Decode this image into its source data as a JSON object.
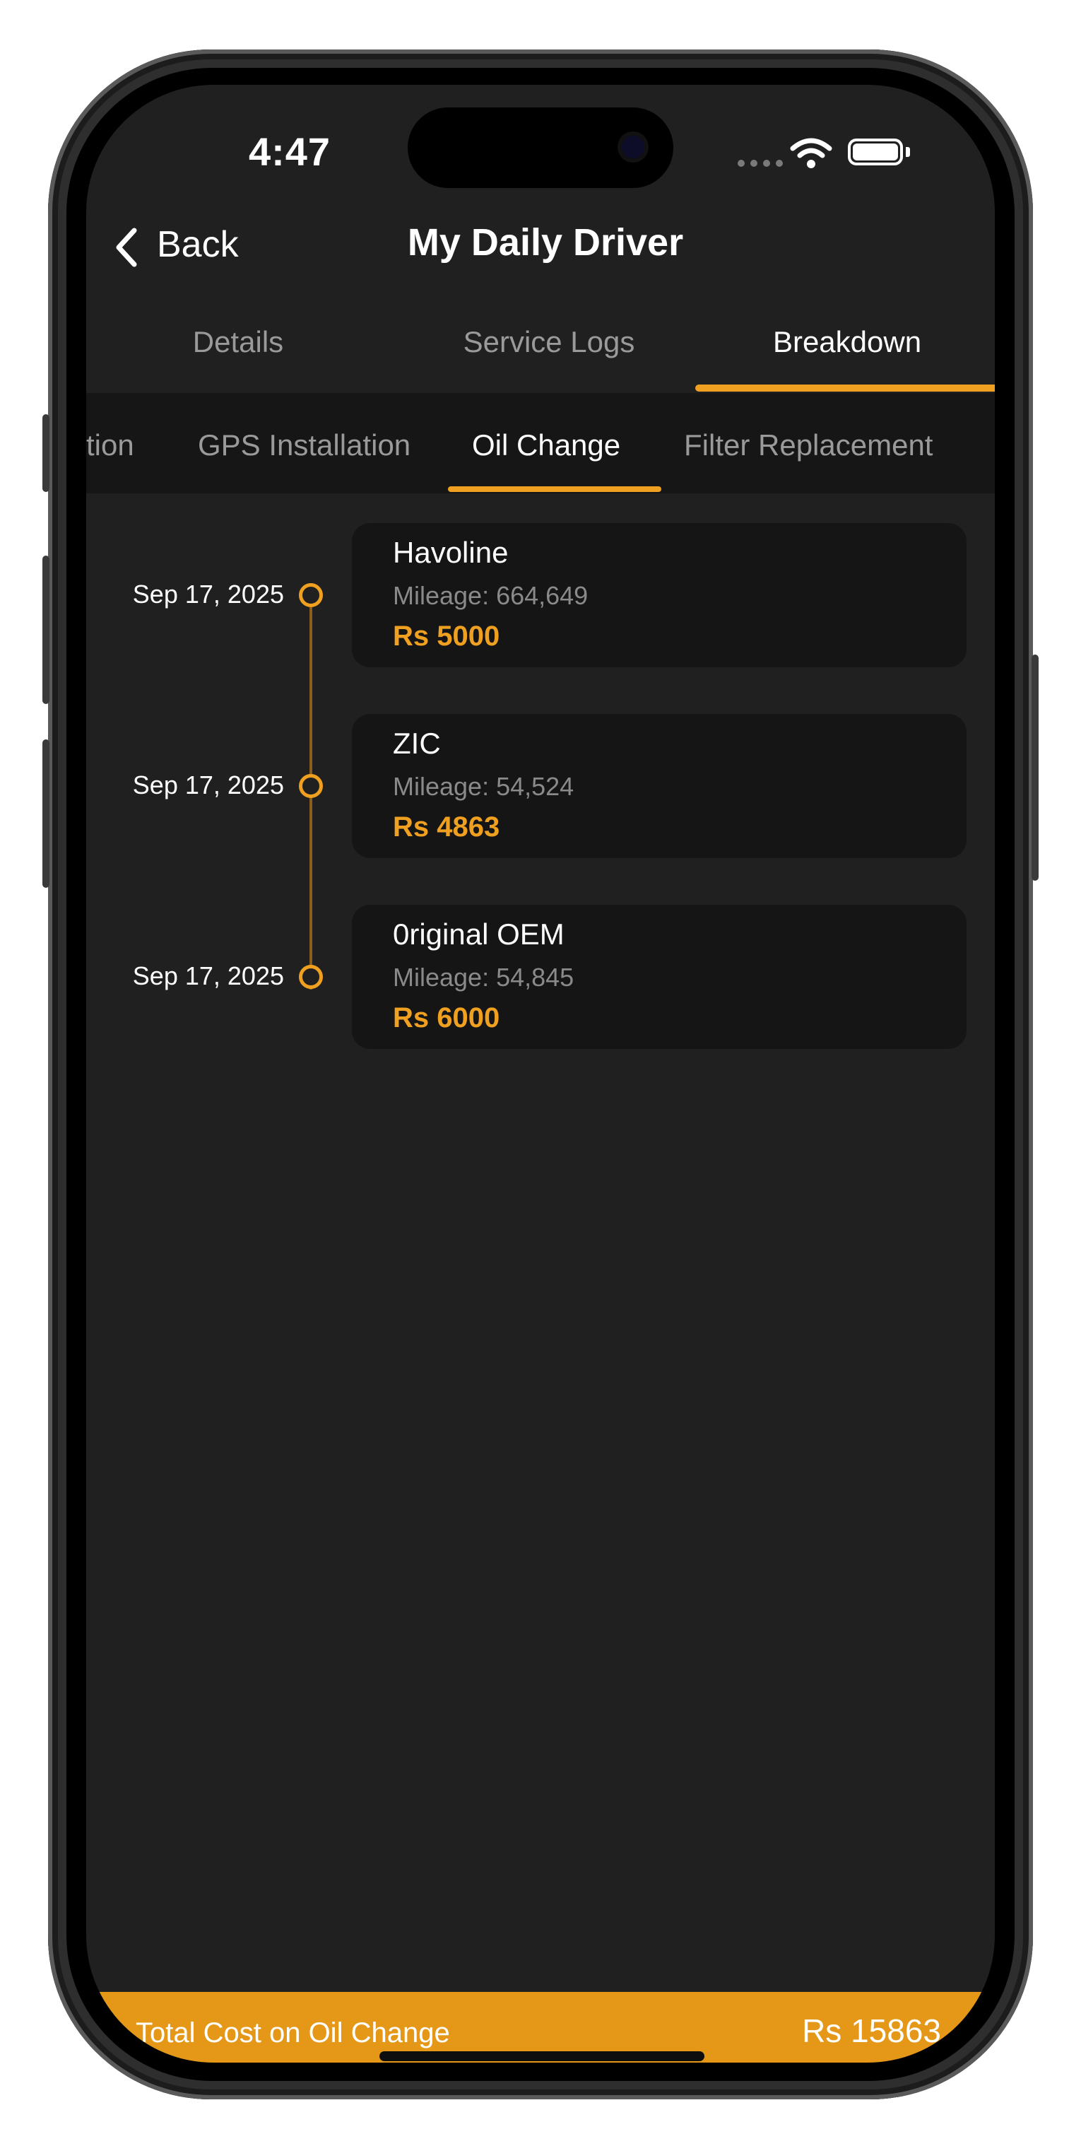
{
  "status_bar": {
    "time": "4:47"
  },
  "header": {
    "back_label": "Back",
    "title": "My Daily Driver"
  },
  "main_tabs": [
    {
      "label": "Details"
    },
    {
      "label": "Service Logs"
    },
    {
      "label": "Breakdown"
    }
  ],
  "active_main_tab": "Breakdown",
  "sub_tabs": [
    {
      "label": "tion"
    },
    {
      "label": "GPS Installation"
    },
    {
      "label": "Oil Change"
    },
    {
      "label": "Filter Replacement"
    }
  ],
  "active_sub_tab": "Oil Change",
  "entries": [
    {
      "date": "Sep 17, 2025",
      "title": "Havoline",
      "mileage": "Mileage: 664,649",
      "cost": "Rs 5000"
    },
    {
      "date": "Sep 17, 2025",
      "title": "ZIC",
      "mileage": "Mileage: 54,524",
      "cost": "Rs 4863"
    },
    {
      "date": "Sep 17, 2025",
      "title": "0riginal OEM",
      "mileage": "Mileage: 54,845",
      "cost": "Rs 6000"
    }
  ],
  "footer": {
    "label": "Total Cost on Oil Change",
    "total": "Rs  15863"
  },
  "colors": {
    "accent": "#f0a020",
    "footer_bg": "#e59818",
    "screen_bg": "#202020",
    "card_bg": "#151515"
  }
}
